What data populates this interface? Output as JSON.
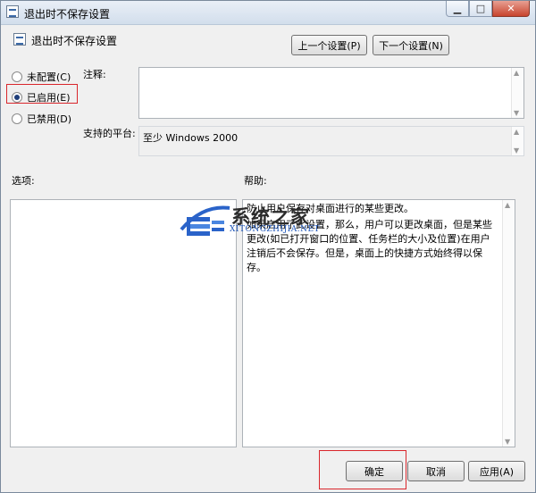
{
  "window": {
    "title": "退出时不保存设置",
    "minimize_glyph": "▁",
    "maximize_glyph": "□",
    "close_glyph": "✕"
  },
  "setting": {
    "name": "退出时不保存设置"
  },
  "nav": {
    "prev_label": "上一个设置(P)",
    "next_label": "下一个设置(N)"
  },
  "state": {
    "options": [
      {
        "label": "未配置(C)",
        "checked": false
      },
      {
        "label": "已启用(E)",
        "checked": true
      },
      {
        "label": "已禁用(D)",
        "checked": false
      }
    ]
  },
  "comment": {
    "label": "注释:",
    "value": ""
  },
  "platform": {
    "label": "支持的平台:",
    "value": "至少 Windows 2000"
  },
  "options_panel": {
    "label": "选项:"
  },
  "help_panel": {
    "label": "帮助:",
    "paragraph1": "防止用户保存对桌面进行的某些更改。",
    "paragraph2": "如果启用了此设置，那么，用户可以更改桌面，但是某些更改(如已打开窗口的位置、任务栏的大小及位置)在用户注销后不会保存。但是，桌面上的快捷方式始终得以保存。"
  },
  "watermark": {
    "text": "系统之家",
    "sub": "XITONGZHIJIA.NET"
  },
  "footer": {
    "ok_label": "确定",
    "cancel_label": "取消",
    "apply_label": "应用(A)"
  },
  "colors": {
    "highlight": "#d9262b",
    "title_bar": "#d2deec",
    "close_button": "#c7442d"
  }
}
